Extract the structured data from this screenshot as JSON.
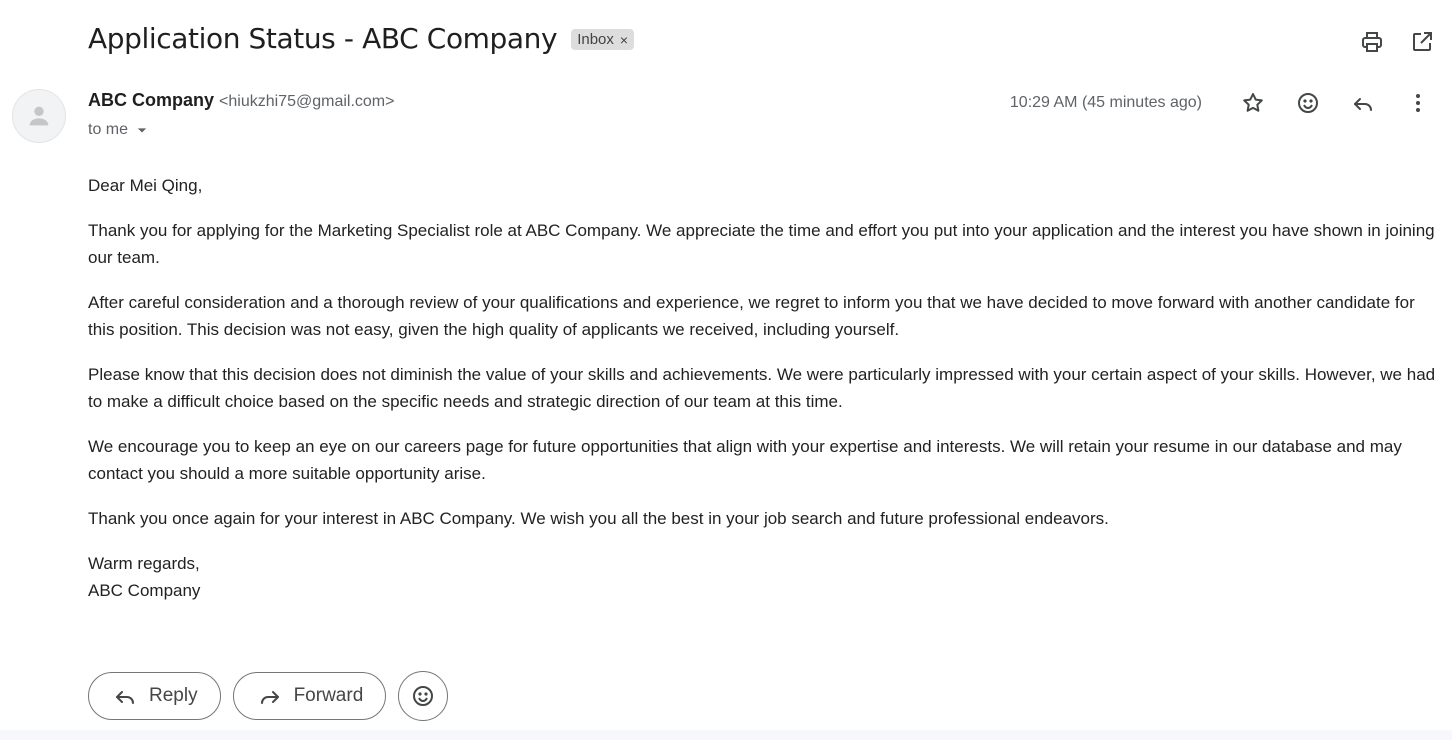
{
  "email": {
    "subject": "Application Status - ABC Company",
    "label": "Inbox",
    "label_remove": "×",
    "sender_name": "ABC Company",
    "sender_email": "<hiukzhi75@gmail.com>",
    "to": "to me",
    "timestamp": "10:29 AM (45 minutes ago)",
    "body": {
      "greeting": "Dear Mei Qing,",
      "p1": "Thank you for applying for the Marketing Specialist role at ABC Company. We appreciate the time and effort you put into your application and the interest you have shown in joining our team.",
      "p2": "After careful consideration and a thorough review of your qualifications and experience, we regret to inform you that we have decided to move forward with another candidate for this position. This decision was not easy, given the high quality of applicants we received, including yourself.",
      "p3": "Please know that this decision does not diminish the value of your skills and achievements. We were particularly impressed with your certain aspect of your skills. However, we had to make a difficult choice based on the specific needs and strategic direction of our team at this time.",
      "p4": "We encourage you to keep an eye on our careers page for future opportunities that align with your expertise and interests. We will retain your resume in our database and may contact you should a more suitable opportunity arise.",
      "p5": "Thank you once again for your interest in ABC Company. We wish you all the best in your job search and future professional endeavors.",
      "closing": "Warm regards,",
      "signature": "ABC Company"
    }
  },
  "actions": {
    "reply_label": "Reply",
    "forward_label": "Forward"
  },
  "icons": {
    "print": "print-icon",
    "open_new": "open-in-new-window-icon",
    "star": "star-icon",
    "emoji": "emoji-icon",
    "reply": "reply-icon",
    "more": "more-vertical-icon"
  },
  "colors": {
    "icon": "#444746",
    "muted_text": "#5f6368",
    "chip_bg": "#dddddd"
  }
}
